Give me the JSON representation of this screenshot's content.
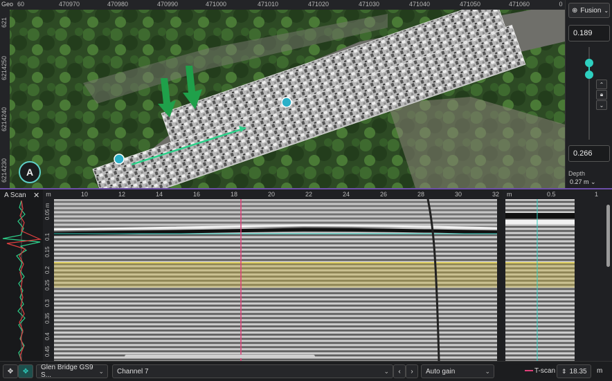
{
  "map": {
    "geo_label": "Geo",
    "top_ticks": [
      "60",
      "470970",
      "470980",
      "470990",
      "471000",
      "471010",
      "471020",
      "471030",
      "471040",
      "471050",
      "471060",
      "0"
    ],
    "left_ticks": [
      "621",
      "6214250",
      "6214240",
      "6214230"
    ],
    "compass_label": "A"
  },
  "right_panel": {
    "mode": "Fusion",
    "top_value": "0.189",
    "bottom_value": "0.266",
    "depth_label": "Depth",
    "depth_value": "0.27 m",
    "slider_top_fraction": 0.189,
    "slider_bottom_fraction": 0.266
  },
  "ascan": {
    "title": "A Scan",
    "close": "✕"
  },
  "radargram": {
    "unit": "m",
    "x_ticks": [
      "10",
      "12",
      "14",
      "16",
      "18",
      "20",
      "22",
      "24",
      "26",
      "28",
      "30",
      "32"
    ],
    "depth_unit": "0.05 m",
    "depth_ticks": [
      "0.1",
      "0.15",
      "0.2",
      "0.25",
      "0.3",
      "0.35",
      "0.4",
      "0.45"
    ]
  },
  "tscan_view": {
    "unit": "m",
    "ticks": [
      "0.5",
      "1"
    ]
  },
  "toolbar": {
    "project": "Glen Bridge GS9 S...",
    "channel": "Channel 7",
    "gain": "Auto gain",
    "tscan_label": "T-scan",
    "position_value": "18.35",
    "position_unit": "m"
  },
  "colors": {
    "accent": "#2ed0c0",
    "cursor": "#e0407a",
    "band": "#c8b34a",
    "divider": "#6c4ea8"
  }
}
